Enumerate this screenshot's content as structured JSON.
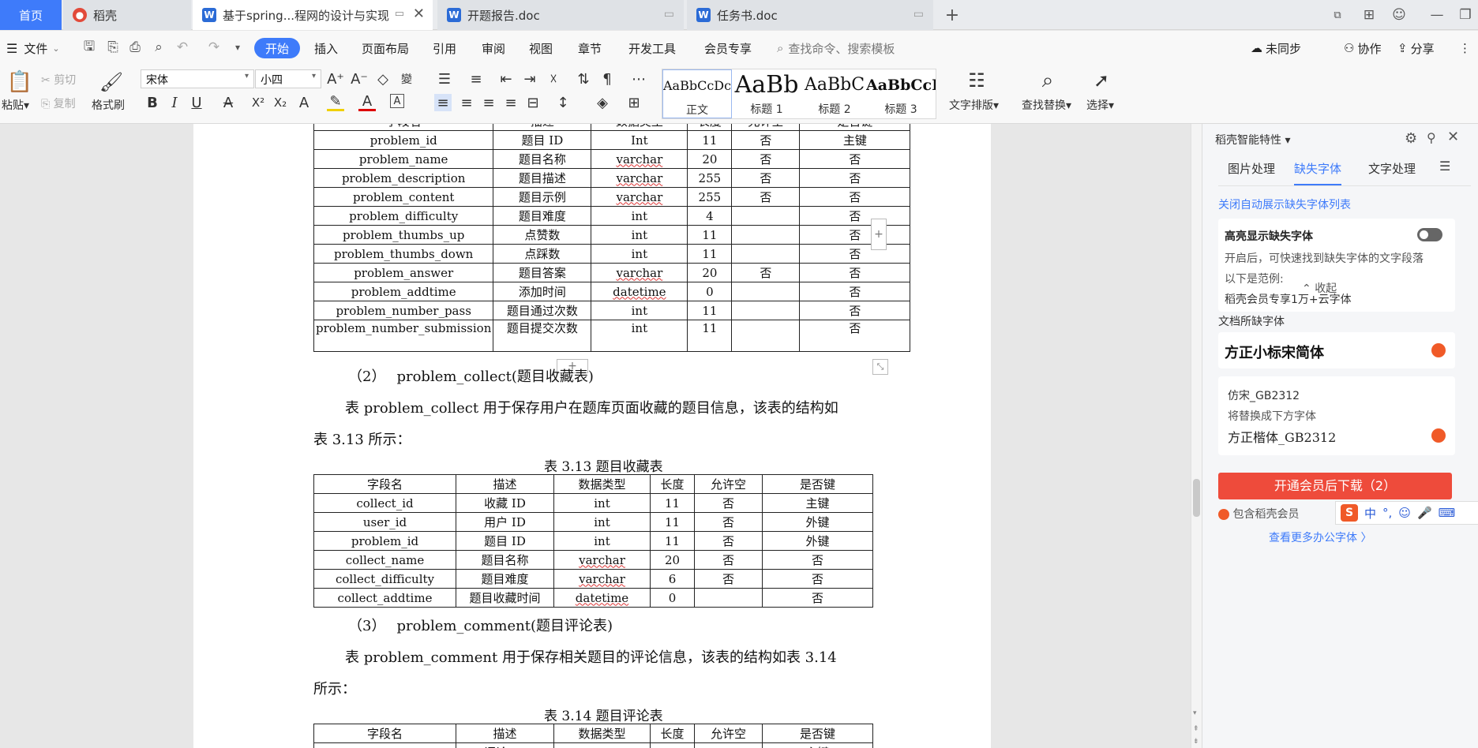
{
  "tabs": {
    "home": "首页",
    "daoke": "稻壳",
    "active_doc": "基于spring...程网的设计与实现",
    "doc2": "开题报告.doc",
    "doc3": "任务书.doc",
    "add": "+"
  },
  "menu": {
    "file": "文件",
    "items": [
      "开始",
      "插入",
      "页面布局",
      "引用",
      "审阅",
      "视图",
      "章节",
      "开发工具",
      "会员专享"
    ],
    "search_placeholder": "查找命令、搜索模板",
    "unsynced": "未同步",
    "collab": "协作",
    "share": "分享"
  },
  "ribbon": {
    "paste": "粘贴",
    "cut": "剪切",
    "copy": "复制",
    "format_painter": "格式刷",
    "font_name": "宋体",
    "font_size": "小四",
    "styles": [
      {
        "sample": "AaBbCcDc",
        "label": "正文"
      },
      {
        "sample": "AaBb",
        "label": "标题 1"
      },
      {
        "sample": "AaBbC",
        "label": "标题 2"
      },
      {
        "sample": "AaBbCcI",
        "label": "标题 3"
      }
    ],
    "text_layout": "文字排版",
    "find_replace": "查找替换",
    "select": "选择"
  },
  "doc": {
    "table1_rows": [
      [
        "problem_id",
        "题目 ID",
        "Int",
        "11",
        "否",
        "主键"
      ],
      [
        "problem_name",
        "题目名称",
        "varchar",
        "20",
        "否",
        "否"
      ],
      [
        "problem_description",
        "题目描述",
        "varchar",
        "255",
        "否",
        "否"
      ],
      [
        "problem_content",
        "题目示例",
        "varchar",
        "255",
        "否",
        "否"
      ],
      [
        "problem_difficulty",
        "题目难度",
        "int",
        "4",
        "",
        "否"
      ],
      [
        "problem_thumbs_up",
        "点赞数",
        "int",
        "11",
        "",
        "否"
      ],
      [
        "problem_thumbs_down",
        "点踩数",
        "int",
        "11",
        "",
        "否"
      ],
      [
        "problem_answer",
        "题目答案",
        "varchar",
        "20",
        "否",
        "否"
      ],
      [
        "problem_addtime",
        "添加时间",
        "datetime",
        "0",
        "",
        "否"
      ],
      [
        "problem_number_pass",
        "题目通过次数",
        "int",
        "11",
        "",
        "否"
      ],
      [
        "problem_number_submission",
        "题目提交次数",
        "int",
        "11",
        "",
        "否"
      ]
    ],
    "section2_num": "（2）",
    "section2_title": "problem_collect(题目收藏表)",
    "para2_line1": "表 problem_collect 用于保存用户在题库页面收藏的题目信息，该表的结构如",
    "para2_line2": "表 3.13 所示：",
    "caption2": "表 3.13 题目收藏表",
    "headers": [
      "字段名",
      "描述",
      "数据类型",
      "长度",
      "允许空",
      "是否键"
    ],
    "table2_rows": [
      [
        "collect_id",
        "收藏 ID",
        "int",
        "11",
        "否",
        "主键"
      ],
      [
        "user_id",
        "用户 ID",
        "int",
        "11",
        "否",
        "外键"
      ],
      [
        "problem_id",
        "题目 ID",
        "int",
        "11",
        "否",
        "外键"
      ],
      [
        "collect_name",
        "题目名称",
        "varchar",
        "20",
        "否",
        "否"
      ],
      [
        "collect_difficulty",
        "题目难度",
        "varchar",
        "6",
        "否",
        "否"
      ],
      [
        "collect_addtime",
        "题目收藏时间",
        "datetime",
        "0",
        "",
        "否"
      ]
    ],
    "section3_num": "（3）",
    "section3_title": "problem_comment(题目评论表)",
    "para3_line1": "表 problem_comment 用于保存相关题目的评论信息，该表的结构如表 3.14",
    "para3_line2": "所示：",
    "caption3": "表 3.14 题目评论表",
    "table3_partial": [
      "评论 ID",
      "主键"
    ]
  },
  "panel": {
    "title": "稻壳智能特性",
    "tabs": [
      "图片处理",
      "缺失字体",
      "文字处理"
    ],
    "close_auto": "关闭自动展示缺失字体列表",
    "highlight_title": "高亮显示缺失字体",
    "highlight_desc": "开启后，可快速找到缺失字体的文字段落",
    "example_label": "以下是范例:",
    "example_text": "稻壳会员专享1万+云字体",
    "collapse": "收起",
    "missing_label": "文档所缺字体",
    "font1": "方正小标宋简体",
    "font2_orig": "仿宋_GB2312",
    "replace_note": "将替换成下方字体",
    "font2_new": "方正楷体_GB2312",
    "download_btn": "开通会员后下载（2）",
    "includes": "包含稻壳会员",
    "more_fonts": "查看更多办公字体 〉"
  },
  "ime": {
    "lang": "中",
    "punct": "°,"
  }
}
